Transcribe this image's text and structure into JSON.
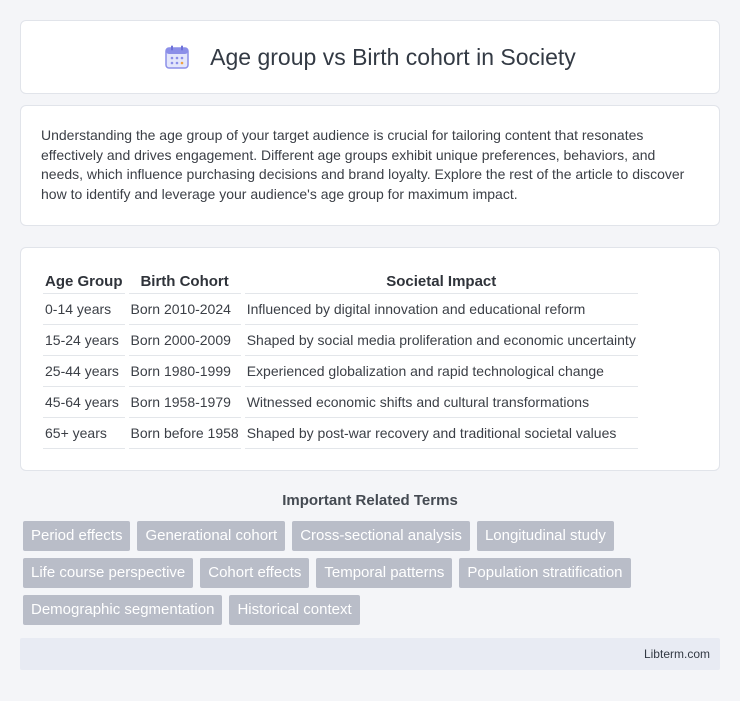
{
  "header": {
    "title": "Age group vs Birth cohort in Society",
    "icon": "calendar-icon"
  },
  "intro": {
    "text": "Understanding the age group of your target audience is crucial for tailoring content that resonates effectively and drives engagement. Different age groups exhibit unique preferences, behaviors, and needs, which influence purchasing decisions and brand loyalty. Explore the rest of the article to discover how to identify and leverage your audience's age group for maximum impact."
  },
  "table": {
    "headers": [
      "Age Group",
      "Birth Cohort",
      "Societal Impact"
    ],
    "rows": [
      [
        "0-14 years",
        "Born 2010-2024",
        "Influenced by digital innovation and educational reform"
      ],
      [
        "15-24 years",
        "Born 2000-2009",
        "Shaped by social media proliferation and economic uncertainty"
      ],
      [
        "25-44 years",
        "Born 1980-1999",
        "Experienced globalization and rapid technological change"
      ],
      [
        "45-64 years",
        "Born 1958-1979",
        "Witnessed economic shifts and cultural transformations"
      ],
      [
        "65+ years",
        "Born before 1958",
        "Shaped by post-war recovery and traditional societal values"
      ]
    ]
  },
  "related": {
    "title": "Important Related Terms",
    "tags": [
      "Period effects",
      "Generational cohort",
      "Cross-sectional analysis",
      "Longitudinal study",
      "Life course perspective",
      "Cohort effects",
      "Temporal patterns",
      "Population stratification",
      "Demographic segmentation",
      "Historical context"
    ]
  },
  "footer": {
    "text": "Libterm.com"
  },
  "colors": {
    "tag_bg": "#b9bdc8",
    "footer_bg": "#e8ebf3",
    "icon_accent": "#8b8fe8"
  }
}
